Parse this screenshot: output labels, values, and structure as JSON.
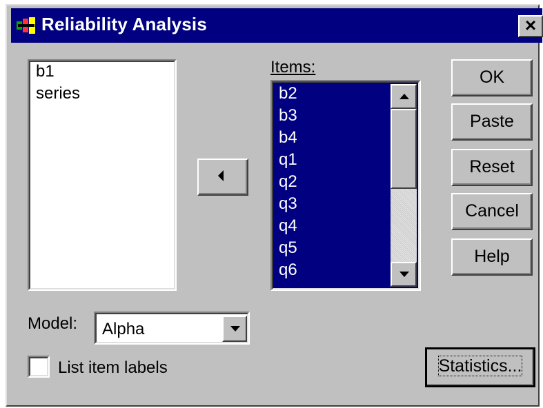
{
  "window": {
    "title": "Reliability Analysis",
    "close_label": "×"
  },
  "source_list": {
    "items": [
      "b1",
      "series"
    ]
  },
  "items_list": {
    "label": "Items:",
    "items": [
      "b2",
      "b3",
      "b4",
      "q1",
      "q2",
      "q3",
      "q4",
      "q5",
      "q6"
    ]
  },
  "buttons": {
    "ok": "OK",
    "paste": "Paste",
    "reset": "Reset",
    "cancel": "Cancel",
    "help": "Help",
    "statistics": "Statistics..."
  },
  "model": {
    "label": "Model:",
    "value": "Alpha"
  },
  "options": {
    "list_item_labels": "List item labels",
    "list_item_labels_checked": false
  },
  "colors": {
    "title_bar": "#000080",
    "dialog_face": "#c0c0c0",
    "selection": "#000080"
  },
  "icons": {
    "move": "left-arrow-icon",
    "title": "app-icon"
  }
}
